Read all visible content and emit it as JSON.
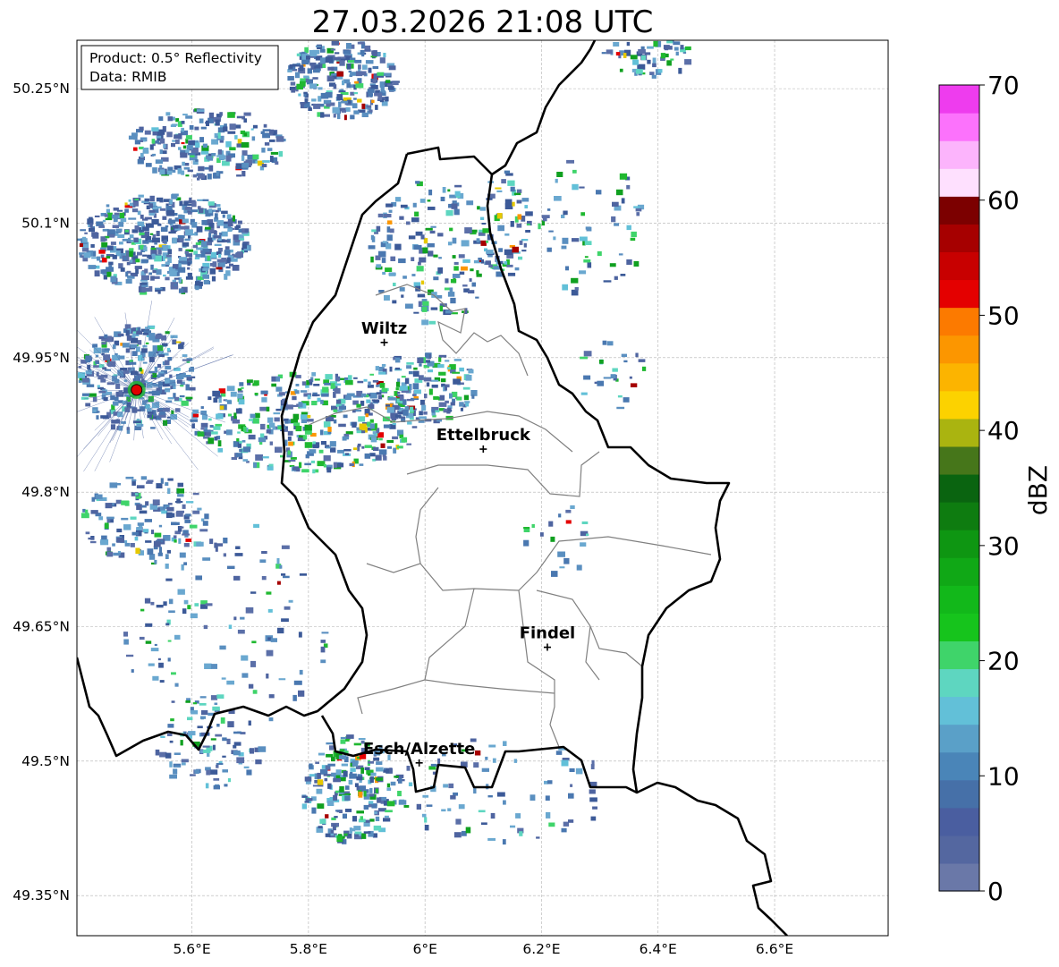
{
  "title": "27.03.2026 21:08 UTC",
  "info_box": {
    "product": "Product: 0.5° Reflectivity",
    "source": "Data: RMIB"
  },
  "lat_labels": [
    "50.25°N",
    "50.1°N",
    "49.95°N",
    "49.8°N",
    "49.65°N",
    "49.5°N",
    "49.35°N"
  ],
  "lon_labels": [
    "5.6°E",
    "5.8°E",
    "6°E",
    "6.2°E",
    "6.4°E",
    "6.6°E"
  ],
  "cities": [
    {
      "name": "Wiltz",
      "lon": 5.93,
      "lat": 49.967
    },
    {
      "name": "Ettelbruck",
      "lon": 6.1,
      "lat": 49.848
    },
    {
      "name": "Findel",
      "lon": 6.21,
      "lat": 49.627
    },
    {
      "name": "Esch/Alzette",
      "lon": 5.99,
      "lat": 49.498
    }
  ],
  "radar_site": {
    "lon": 5.505,
    "lat": 49.914
  },
  "colorbar": {
    "label": "dBZ",
    "ticks": [
      "0",
      "10",
      "20",
      "30",
      "40",
      "50",
      "60",
      "70"
    ],
    "min": 0,
    "max": 70,
    "step": 2.5,
    "colors": [
      "#6a78a8",
      "#5467a0",
      "#4a5ea0",
      "#4670a8",
      "#4a85b8",
      "#5aa0c8",
      "#62c0d8",
      "#5ed6c0",
      "#3fd46a",
      "#16c41c",
      "#12b81a",
      "#10a816",
      "#0e9612",
      "#0e7c10",
      "#0a6410",
      "#46761a",
      "#aab410",
      "#fcd200",
      "#fcb400",
      "#fc9600",
      "#fc7a00",
      "#e40000",
      "#c80000",
      "#a60000",
      "#7c0000",
      "#fee0fe",
      "#fcb4fc",
      "#fc72fc",
      "#ee3cee"
    ]
  }
}
